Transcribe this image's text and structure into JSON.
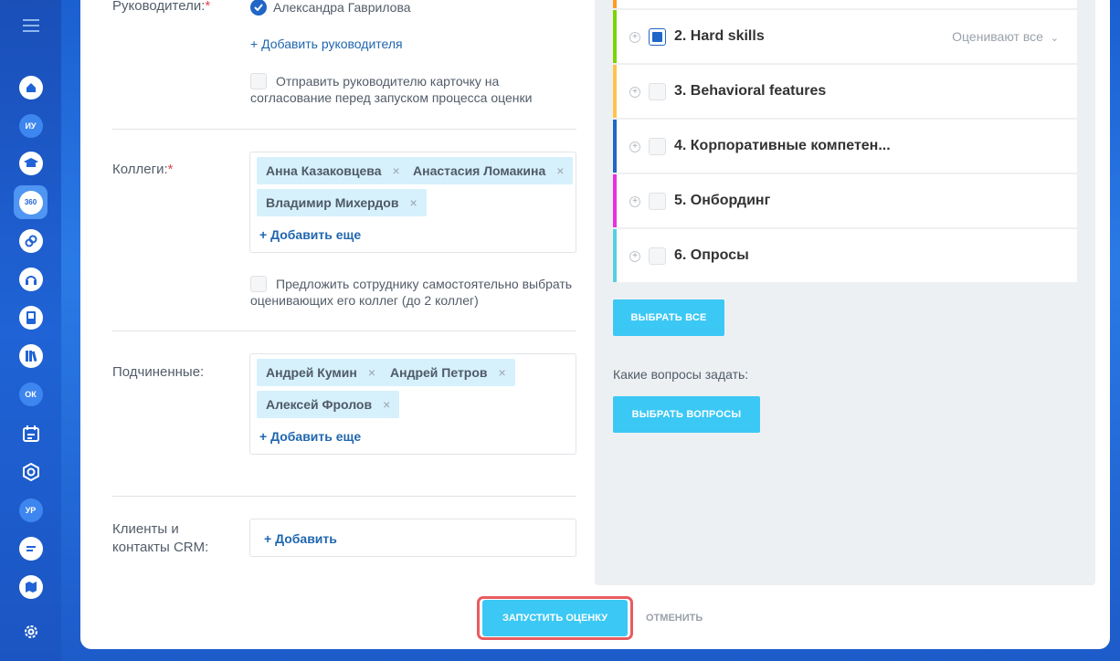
{
  "form": {
    "managers_label": "Руководители:",
    "required_mark": "*",
    "selected_manager": "Александра Гаврилова",
    "add_manager": "+ Добавить руководителя",
    "send_card_line1": "Отправить руководителю карточку на",
    "send_card_line2": "согласование перед запуском процесса оценки",
    "colleagues_label": "Коллеги:",
    "colleagues": [
      "Анна Казаковцева",
      "Анастасия Ломакина",
      "Владимир Михердов"
    ],
    "add_more": "+ Добавить еще",
    "self_select_line1": "Предложить сотруднику самостоятельно выбрать",
    "self_select_line2": "оценивающих его коллег (до 2 коллег)",
    "subordinates_label": "Подчиненные:",
    "subordinates": [
      "Андрей Кумин",
      "Андрей Петров",
      "Алексей Фролов"
    ],
    "clients_label_line1": "Клиенты и",
    "clients_label_line2": "контакты CRM:",
    "add_client": "+ Добавить",
    "remove_glyph": "×"
  },
  "sections": [
    {
      "title": "2. Hard skills",
      "color": "#7bd500",
      "state": "partial",
      "who": "Оценивают все"
    },
    {
      "title": "3. Behavioral features",
      "color": "#ffc34d",
      "state": "empty"
    },
    {
      "title": "4. Корпоративные компетен...",
      "color": "#2066c6",
      "state": "empty"
    },
    {
      "title": "5. Онбординг",
      "color": "#e92fe0",
      "state": "empty"
    },
    {
      "title": "6. Опросы",
      "color": "#55d0e0",
      "state": "empty"
    }
  ],
  "right": {
    "select_all": "ВЫБРАТЬ ВСЕ",
    "questions_label": "Какие вопросы задать:",
    "select_questions": "ВЫБРАТЬ ВОПРОСЫ"
  },
  "footer": {
    "launch": "ЗАПУСТИТЬ ОЦЕНКУ",
    "cancel": "ОТМЕНИТЬ"
  },
  "rail": {
    "badge_iu": "ИУ",
    "badge_360": "360",
    "badge_ok": "ОК",
    "badge_ur": "УР"
  },
  "colors": {
    "accent": "#3bc8f5",
    "link": "#2067b0",
    "required": "#e5424d",
    "tag_bg": "#d6f1fc",
    "highlight": "#e85b60"
  }
}
